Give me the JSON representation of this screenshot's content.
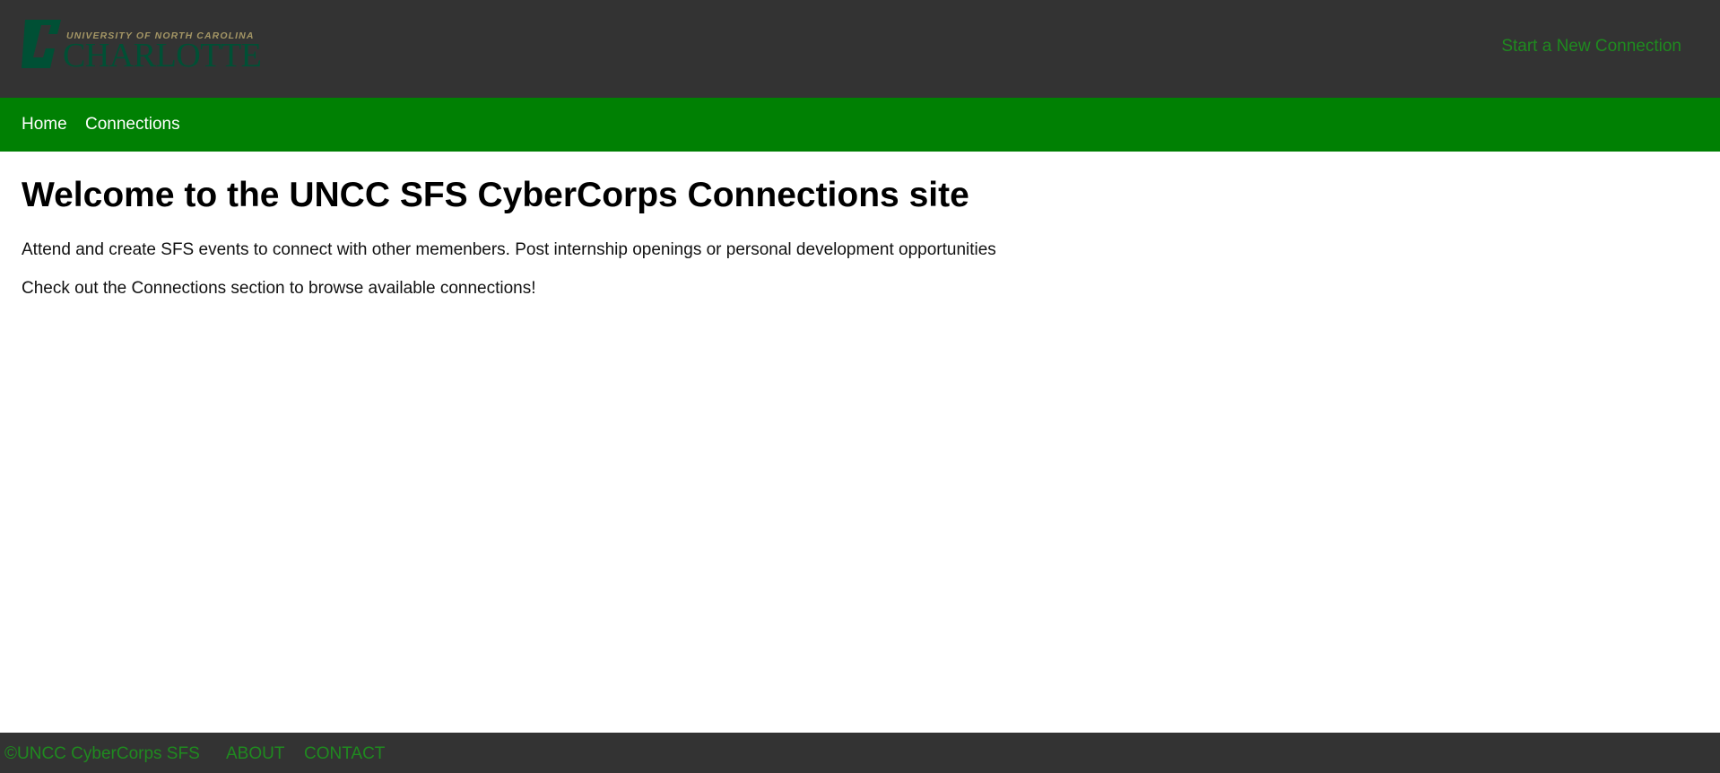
{
  "header": {
    "logo": {
      "top_line": "UNIVERSITY OF NORTH CAROLINA",
      "main_word": "CHARLOTTE"
    },
    "cta_label": "Start a New Connection"
  },
  "nav": {
    "items": [
      {
        "label": "Home"
      },
      {
        "label": "Connections"
      }
    ]
  },
  "main": {
    "title": "Welcome to the UNCC SFS CyberCorps Connections site",
    "paragraphs": [
      "Attend and create SFS events to connect with other memenbers. Post internship openings or personal development opportunities",
      "Check out the Connections section to browse available connections!"
    ]
  },
  "footer": {
    "copyright": "©UNCC CyberCorps SFS",
    "about": "ABOUT",
    "contact": "CONTACT"
  },
  "colors": {
    "header_bg": "#333333",
    "nav_bg": "#008003",
    "link_green": "#1f8a1f",
    "logo_green": "#005035",
    "logo_gold": "#a49665"
  },
  "icons": {
    "logo_mark": "unc-charlotte-c-logo"
  }
}
